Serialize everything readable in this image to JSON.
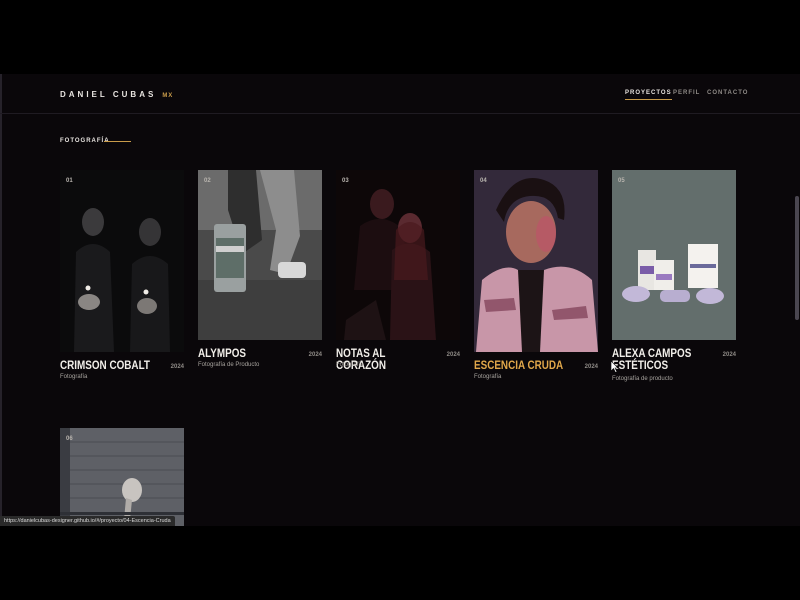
{
  "header": {
    "brand": "DANIEL CUBAS",
    "brand_accent": "MX",
    "nav": [
      "PROYECTOS",
      "PERFIL",
      "CONTACTO"
    ],
    "active_nav": "PROYECTOS"
  },
  "section": {
    "title": "FOTOGRAFÍA"
  },
  "projects": [
    {
      "num": "01",
      "title": "CRIMSON COBALT",
      "year": "2024",
      "category": "Fotografía"
    },
    {
      "num": "02",
      "title": "ALYMPOS",
      "year": "2024",
      "category": "Fotografía de Producto"
    },
    {
      "num": "03",
      "title": "NOTAS AL CORAZÓN",
      "year": "2024",
      "category": "Fotografía"
    },
    {
      "num": "04",
      "title": "ESCENCIA CRUDA",
      "year": "2024",
      "category": "Fotografía",
      "highlighted": true
    },
    {
      "num": "05",
      "title": "ALEXA CAMPOS ESTÉTICOS",
      "year": "2024",
      "category": "Fotografía de producto"
    },
    {
      "num": "06",
      "title": "",
      "year": "",
      "category": ""
    }
  ],
  "status_url": "https://danielcubas-designer.github.io/#/proyecto/04-Escencia-Cruda",
  "colors": {
    "accent": "#c89b4a",
    "highlight": "#e2a84b",
    "background": "#0a070a"
  }
}
